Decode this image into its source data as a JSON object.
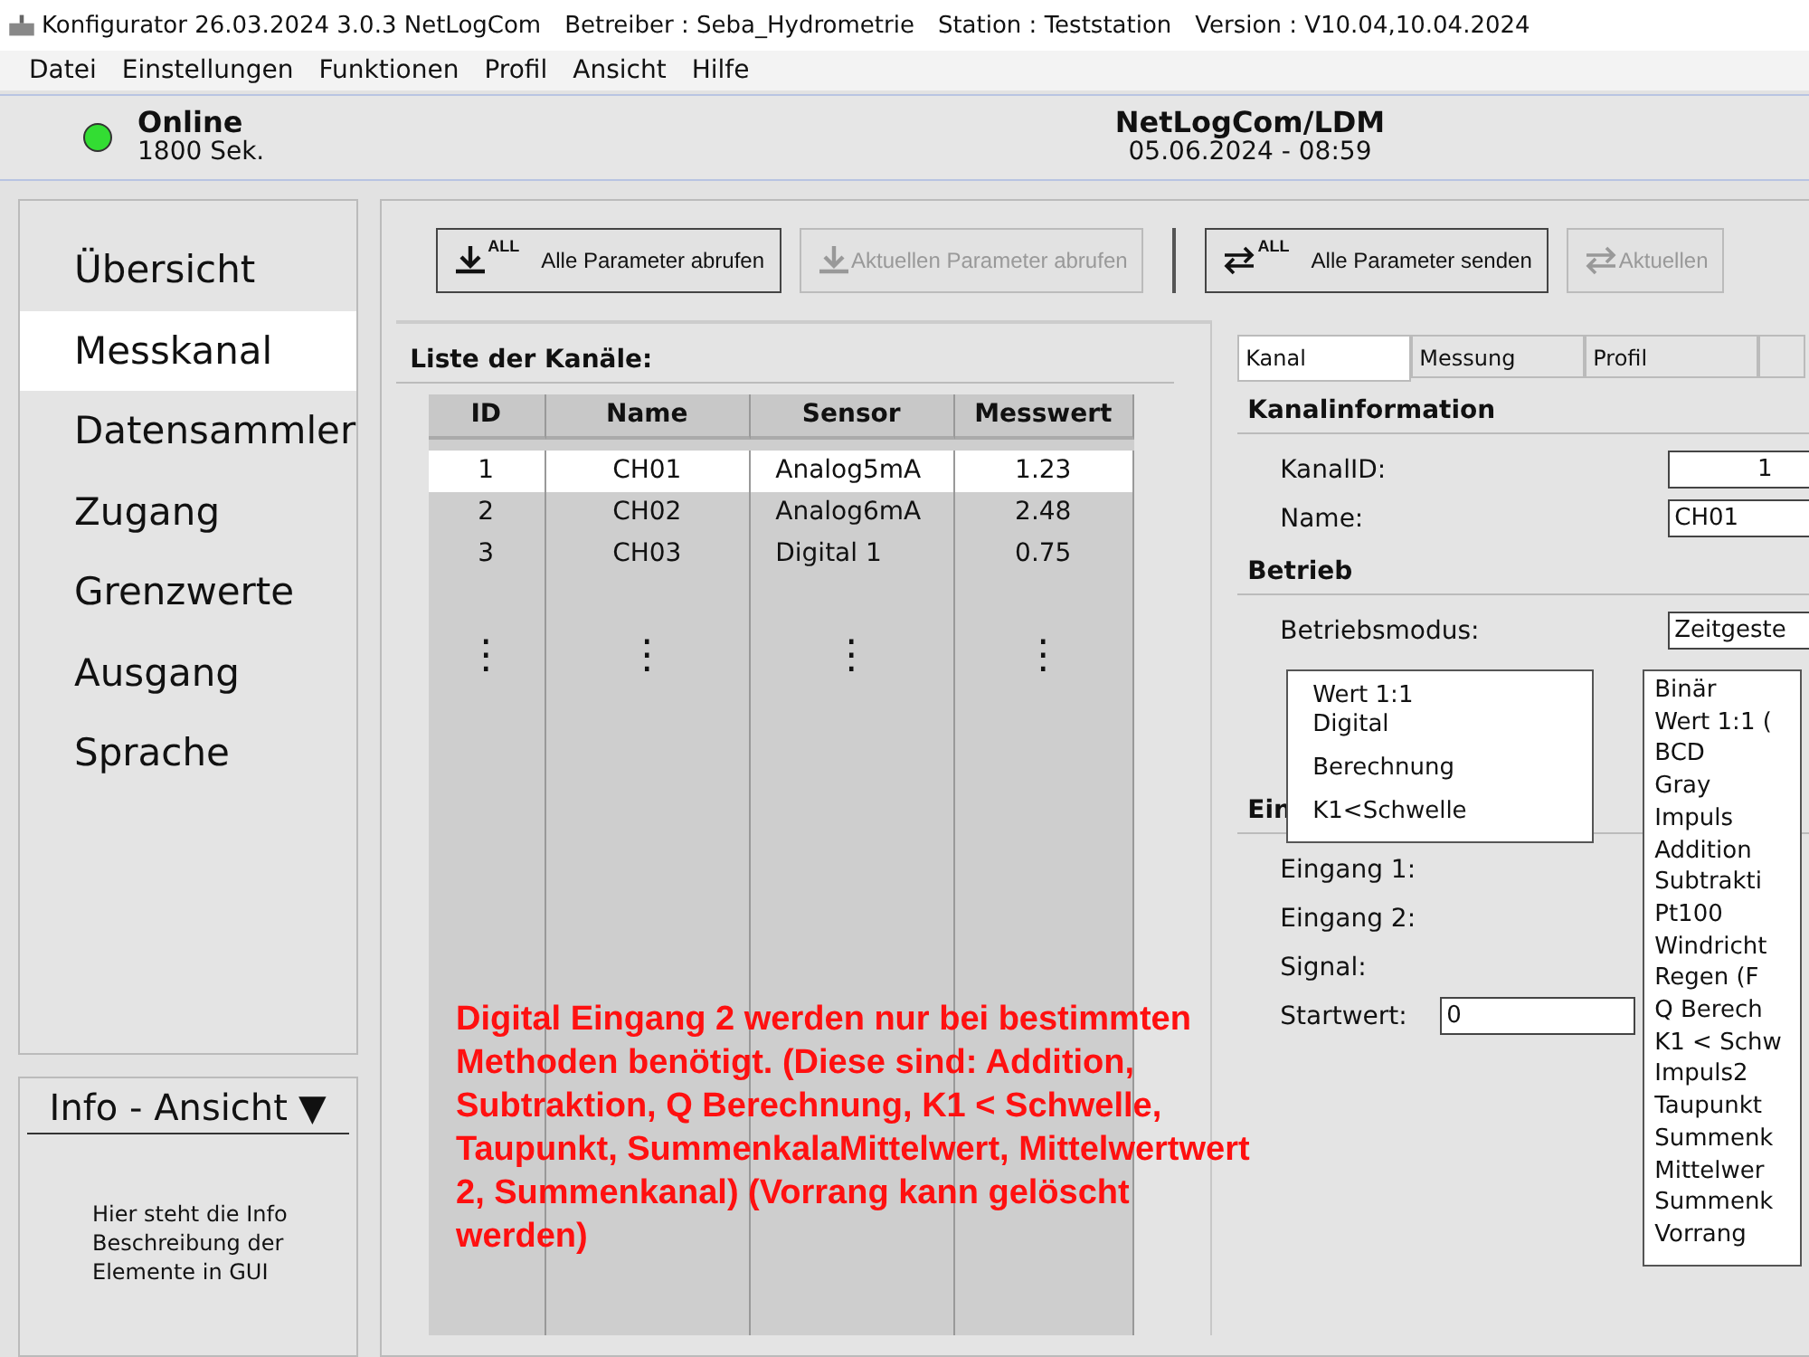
{
  "window": {
    "title": "Konfigurator 26.03.2024 3.0.3 NetLogCom",
    "operator": "Betreiber : Seba_Hydrometrie",
    "station": "Station : Teststation",
    "version": "Version : V10.04,10.04.2024"
  },
  "menu": [
    "Datei",
    "Einstellungen",
    "Funktionen",
    "Profil",
    "Ansicht",
    "Hilfe"
  ],
  "status": {
    "online": true,
    "state": "Online",
    "interval": "1800 Sek.",
    "device": "NetLogCom/LDM",
    "datetime": "05.06.2024 - 08:59"
  },
  "sidebar": {
    "items": [
      {
        "label": "Übersicht",
        "selected": false
      },
      {
        "label": "Messkanal",
        "selected": true
      },
      {
        "label": "Datensammler",
        "selected": false
      },
      {
        "label": "Zugang",
        "selected": false
      },
      {
        "label": "Grenzwerte",
        "selected": false
      },
      {
        "label": "Ausgang",
        "selected": false
      },
      {
        "label": "Sprache",
        "selected": false
      }
    ]
  },
  "info": {
    "title": "Info - Ansicht",
    "caret": "▼",
    "text": "Hier steht die Info Beschreibung der Elemente in GUI"
  },
  "toolbar": [
    {
      "label": "Alle Parameter abrufen",
      "kind": "download",
      "badge": "ALL",
      "disabled": false
    },
    {
      "label": "Aktuellen Parameter abrufen",
      "kind": "download",
      "disabled": true
    },
    {
      "label": "Alle Parameter senden",
      "kind": "sync",
      "badge": "ALL",
      "disabled": false
    },
    {
      "label": "Aktuellen",
      "kind": "sync",
      "disabled": true
    }
  ],
  "table": {
    "title": "Liste der Kanäle:",
    "columns": [
      "ID",
      "Name",
      "Sensor",
      "Messwert"
    ],
    "rows": [
      {
        "cells": [
          "1",
          "CH01",
          "Analog5mA",
          "1.23"
        ],
        "selected": true
      },
      {
        "cells": [
          "2",
          "CH02",
          "Analog6mA",
          "2.48"
        ],
        "selected": false
      },
      {
        "cells": [
          "3",
          "CH03",
          "Digital 1",
          "0.75"
        ],
        "selected": false
      }
    ],
    "more": [
      "⋮",
      "⋮",
      "⋮",
      "⋮"
    ]
  },
  "tabs": [
    {
      "label": "Kanal",
      "selected": true
    },
    {
      "label": "Messung",
      "selected": false
    },
    {
      "label": "Profil",
      "selected": false
    }
  ],
  "kanalinfo": {
    "title": "Kanalinformation",
    "fields": [
      {
        "label": "KanalID:",
        "value": "1"
      },
      {
        "label": "Name:",
        "value": "CH01"
      }
    ]
  },
  "betrieb": {
    "title": "Betrieb",
    "label": "Betriebsmodus:",
    "value": "Zeitgeste"
  },
  "eingang": {
    "title": "Ein",
    "fields": [
      {
        "label": "Eingang 1:"
      },
      {
        "label": "Eingang 2:"
      },
      {
        "label": "Signal:"
      },
      {
        "label": "Startwert:",
        "value": "0"
      }
    ]
  },
  "popup": [
    {
      "label": "Wert 1:1"
    },
    {
      "label": "Digital"
    },
    {
      "label": "Berechnung"
    },
    {
      "label": "K1<Schwelle"
    }
  ],
  "dropdown": [
    "Binär",
    "Wert 1:1 (",
    "BCD",
    "Gray",
    "Impuls",
    "Addition",
    "Subtrakti",
    "Pt100",
    "Windricht",
    "Regen (F",
    "Q Berech",
    "K1 < Schw",
    "Impuls2",
    "Taupunkt",
    "Summenk",
    "Mittelwer",
    "Summenk",
    "Vorrang"
  ],
  "annotation": "Digital Eingang 2 werden nur bei bestimmten Methoden benötigt. (Diese sind: Addition, Subtraktion, Q Berechnung, K1 < Schwelle, Taupunkt, SummenkalaMittelwert, Mittelwertwert 2, Summenkanal) (Vorrang kann gelöscht werden)"
}
